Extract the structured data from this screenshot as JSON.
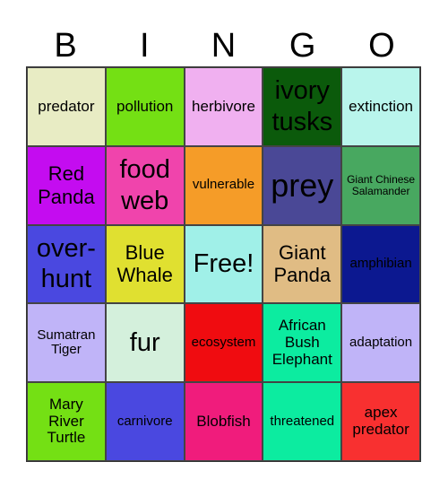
{
  "header": [
    "B",
    "I",
    "N",
    "G",
    "O"
  ],
  "cells": [
    {
      "text": "predator",
      "bg": "#e8ecc4",
      "size": "s-md"
    },
    {
      "text": "pollution",
      "bg": "#74e014",
      "size": "s-md"
    },
    {
      "text": "herbivore",
      "bg": "#f0b0f0",
      "size": "s-md"
    },
    {
      "text": "ivory tusks",
      "bg": "#0b5a0b",
      "size": "s-xl"
    },
    {
      "text": "extinction",
      "bg": "#b9f5ec",
      "size": "s-md"
    },
    {
      "text": "Red Panda",
      "bg": "#c40cf0",
      "size": "s-lg"
    },
    {
      "text": "food web",
      "bg": "#f044ac",
      "size": "s-xl"
    },
    {
      "text": "vulnerable",
      "bg": "#f59c28",
      "size": "s-sm"
    },
    {
      "text": "prey",
      "bg": "#4a4896",
      "size": "s-xxl"
    },
    {
      "text": "Giant Chinese Salamander",
      "bg": "#48a860",
      "size": "s-xs"
    },
    {
      "text": "over-hunt",
      "bg": "#4a48e0",
      "size": "s-xl"
    },
    {
      "text": "Blue Whale",
      "bg": "#e0e030",
      "size": "s-lg"
    },
    {
      "text": "Free!",
      "bg": "#a0f0e8",
      "size": "s-xl"
    },
    {
      "text": "Giant Panda",
      "bg": "#e0bc84",
      "size": "s-lg"
    },
    {
      "text": "amphibian",
      "bg": "#0c1890",
      "size": "s-sm"
    },
    {
      "text": "Sumatran Tiger",
      "bg": "#c0b4f8",
      "size": "s-sm"
    },
    {
      "text": "fur",
      "bg": "#d4f0dc",
      "size": "s-xl"
    },
    {
      "text": "ecosystem",
      "bg": "#f00c10",
      "size": "s-sm"
    },
    {
      "text": "African Bush Elephant",
      "bg": "#0ceca0",
      "size": "s-md"
    },
    {
      "text": "adaptation",
      "bg": "#c0b4f8",
      "size": "s-sm"
    },
    {
      "text": "Mary River Turtle",
      "bg": "#74e014",
      "size": "s-md"
    },
    {
      "text": "carnivore",
      "bg": "#4a48e0",
      "size": "s-sm"
    },
    {
      "text": "Blobfish",
      "bg": "#f01c7c",
      "size": "s-md"
    },
    {
      "text": "threatened",
      "bg": "#0ceca0",
      "size": "s-sm"
    },
    {
      "text": "apex predator",
      "bg": "#f83030",
      "size": "s-md"
    }
  ]
}
